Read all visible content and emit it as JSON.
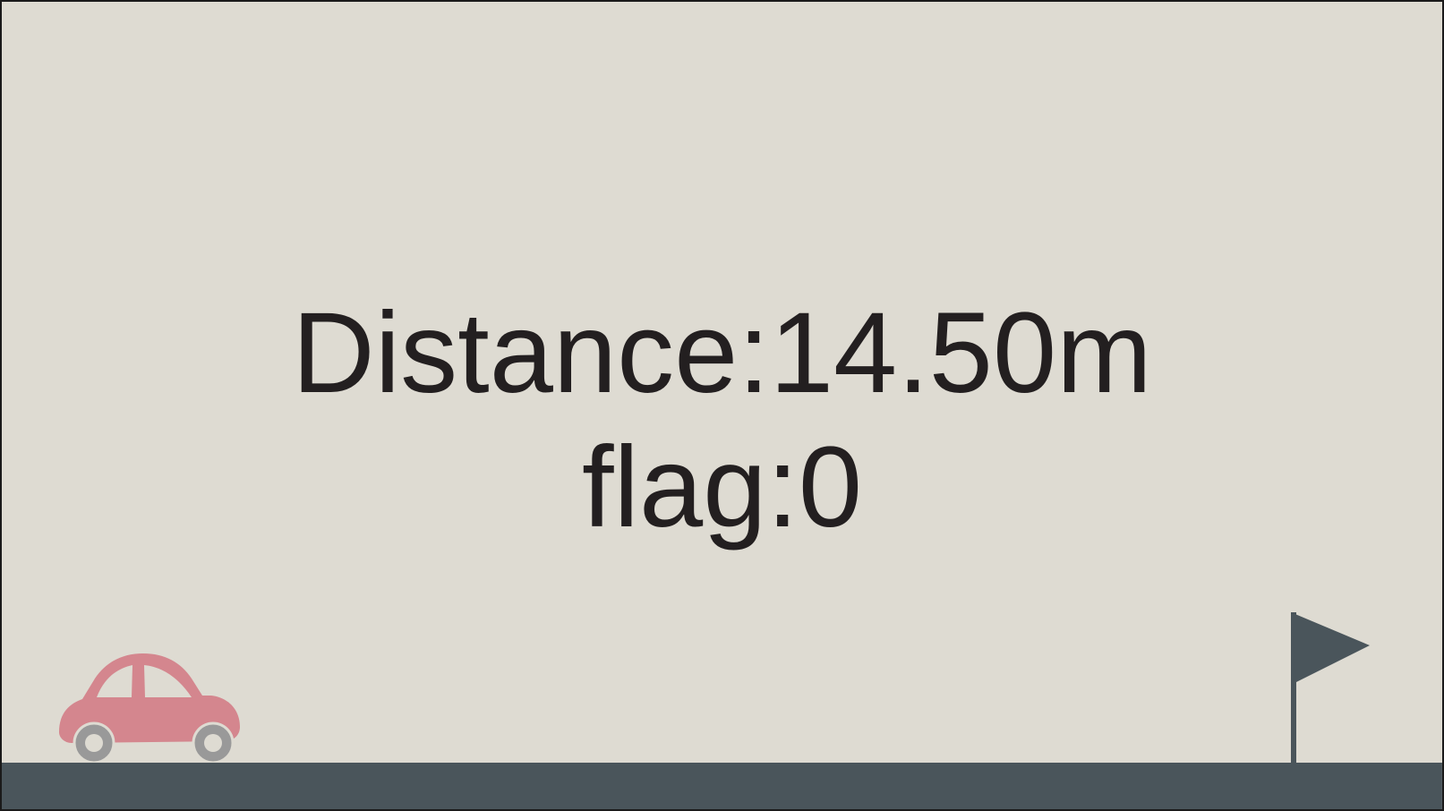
{
  "hud": {
    "distance_text": "Distance:14.50m",
    "flag_text": "flag:0"
  },
  "scene": {
    "player": "car-icon",
    "goal": "flag-icon"
  },
  "colors": {
    "background": "#dedbd2",
    "text": "#231f20",
    "ground": "#4a555b",
    "car_body": "#d4868e",
    "car_window": "#dedbd2",
    "wheel": "#999999",
    "flag": "#4a555b"
  }
}
